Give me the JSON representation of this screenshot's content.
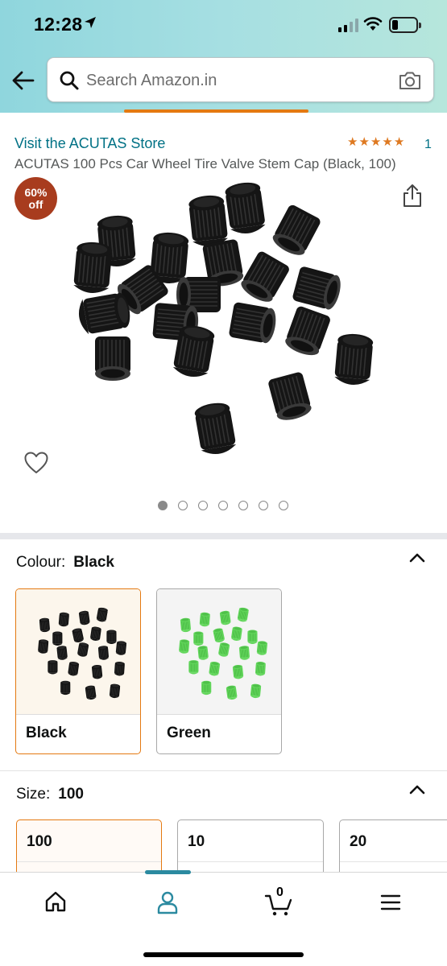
{
  "status_bar": {
    "time": "12:28"
  },
  "search": {
    "placeholder": "Search Amazon.in"
  },
  "product": {
    "store_link": "Visit the ACUTAS Store",
    "rating_count": "1",
    "title": "ACUTAS 100 Pcs Car Wheel Tire Valve Stem Cap (Black, 100)",
    "discount_badge": "60%",
    "discount_suffix": "off",
    "image_count": 7,
    "current_image": 1
  },
  "colour": {
    "label": "Colour:",
    "selected": "Black",
    "options": [
      {
        "label": "Black",
        "color": "#111111"
      },
      {
        "label": "Green",
        "color": "#5fd35a"
      }
    ]
  },
  "size": {
    "label": "Size:",
    "selected": "100",
    "options": [
      "100",
      "10",
      "20"
    ]
  },
  "bottom_nav": {
    "items": [
      "home-icon",
      "account-icon",
      "cart-icon",
      "menu-icon"
    ],
    "cart_count": "0",
    "active": "account"
  },
  "colors": {
    "accent": "#e47911",
    "link": "#007185",
    "badge": "#a83c1e",
    "star": "#de7921"
  }
}
